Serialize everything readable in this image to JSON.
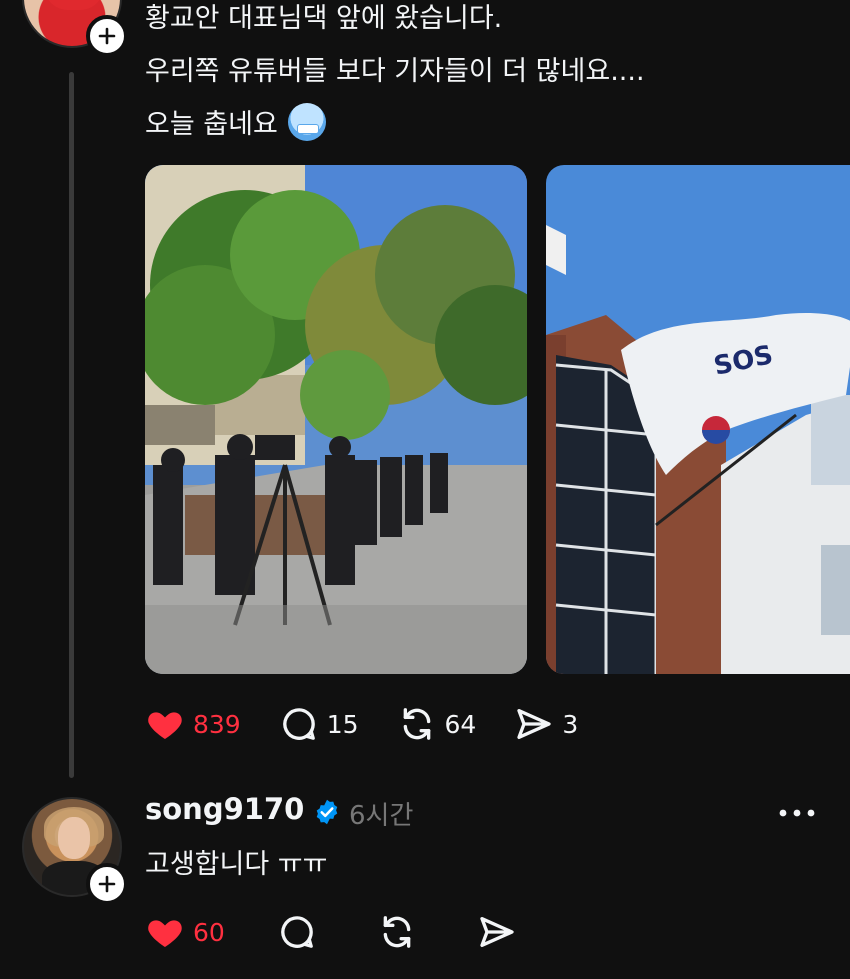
{
  "post": {
    "lines": [
      "황교안 대표님댁 앞에 왔습니다.",
      "우리쪽 유튜버들 보다 기자들이 더 많네요....",
      "오늘 춥네요"
    ],
    "emoji": "cold-face-emoji",
    "actions": {
      "likes": "839",
      "comments": "15",
      "reposts": "64",
      "shares": "3"
    }
  },
  "reply": {
    "username": "song9170",
    "time": "6시간",
    "text": "고생합니다 ㅠㅠ",
    "actions": {
      "likes": "60"
    }
  },
  "colors": {
    "background": "#101010",
    "like_red": "#ff3040",
    "verified_blue": "#0095f6",
    "muted": "#777777"
  }
}
